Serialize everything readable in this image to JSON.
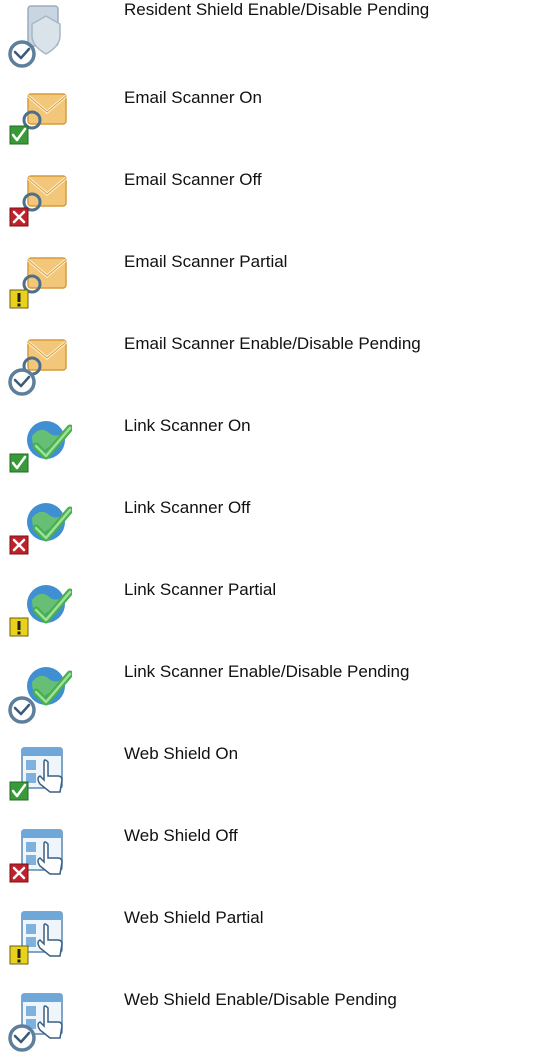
{
  "items": [
    {
      "label": "Resident Shield Enable/Disable Pending",
      "base": "resident-shield",
      "status": "pending"
    },
    {
      "label": "Email Scanner On",
      "base": "email-scanner",
      "status": "on"
    },
    {
      "label": "Email Scanner Off",
      "base": "email-scanner",
      "status": "off"
    },
    {
      "label": "Email Scanner Partial",
      "base": "email-scanner",
      "status": "partial"
    },
    {
      "label": "Email Scanner Enable/Disable Pending",
      "base": "email-scanner",
      "status": "pending"
    },
    {
      "label": "Link Scanner On",
      "base": "link-scanner",
      "status": "on"
    },
    {
      "label": "Link Scanner Off",
      "base": "link-scanner",
      "status": "off"
    },
    {
      "label": "Link Scanner Partial",
      "base": "link-scanner",
      "status": "partial"
    },
    {
      "label": "Link Scanner Enable/Disable Pending",
      "base": "link-scanner",
      "status": "pending"
    },
    {
      "label": "Web Shield On",
      "base": "web-shield",
      "status": "on"
    },
    {
      "label": "Web Shield Off",
      "base": "web-shield",
      "status": "off"
    },
    {
      "label": "Web Shield Partial",
      "base": "web-shield",
      "status": "partial"
    },
    {
      "label": "Web Shield Enable/Disable Pending",
      "base": "web-shield",
      "status": "pending"
    }
  ],
  "colors": {
    "on": "#3a9a3a",
    "off": "#c0202a",
    "partial": "#e8d21e",
    "pending_ring": "#5d7f9c",
    "envelope": "#f3c77a",
    "globe": "#3f8fd2",
    "window": "#6fa7d8"
  }
}
